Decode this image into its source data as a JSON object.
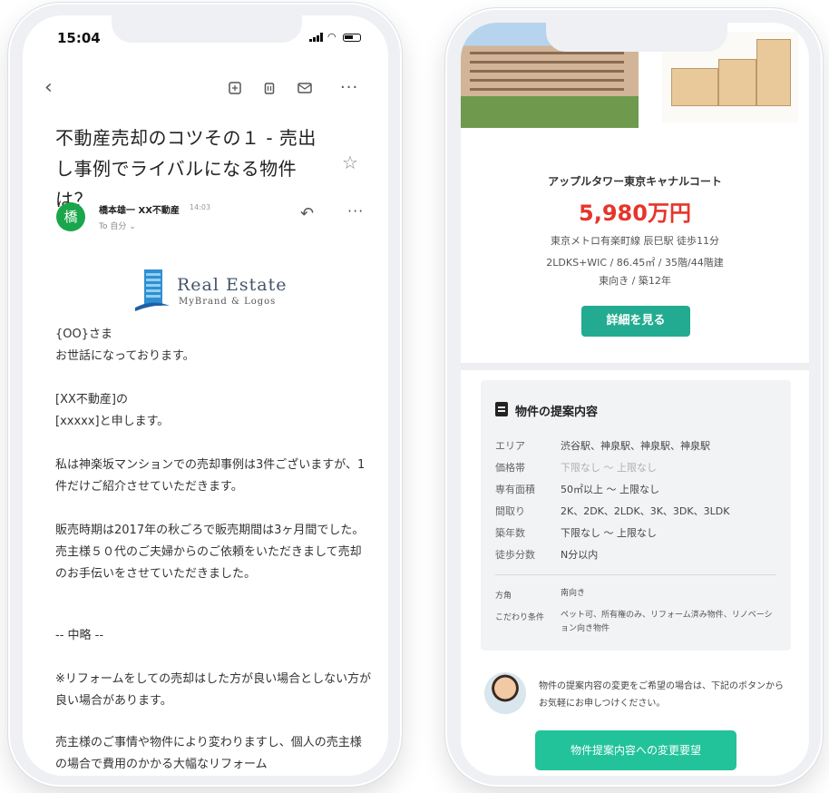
{
  "email": {
    "status_time": "15:04",
    "subject": "不動産売却のコツその１ - 売出し事例でライバルになる物件は？",
    "sender": {
      "initial": "橋",
      "name": "橋本雄一 XX不動産",
      "time": "14:03",
      "to": "To 自分 ⌄"
    },
    "logo": {
      "title": "Real Estate",
      "subtitle": "MyBrand & Logos"
    },
    "body": [
      "{OO}さま\nお世話になっております。",
      "[XX不動産]の\n[xxxxx]と申します。",
      "私は神楽坂マンションでの売却事例は3件ございますが、1件だけご紹介させていただきます。",
      "販売時期は2017年の秋ごろで販売期間は3ヶ月間でした。売主様５０代のご夫婦からのご依頼をいただきまして売却のお手伝いをさせていただきました。",
      "-- 中略 --",
      "※リフォームをしての売却はした方が良い場合としない方が良い場合があります。",
      "売主様のご事情や物件により変わりますし、個人の売主様の場合で費用のかかる大幅なリフォーム"
    ]
  },
  "property": {
    "name": "アップルタワー東京キャナルコート",
    "price": "5,980万円",
    "station": "東京メトロ有楽町線 辰巳駅 徒歩11分",
    "spec": "2LDKS+WIC / 86.45㎡ / 35階/44階建",
    "orientation": "東向き / 築12年",
    "detail_button": "詳細を見る"
  },
  "proposal": {
    "title": "物件の提案内容",
    "conditions": [
      {
        "label": "エリア",
        "value": "渋谷駅、神泉駅、神泉駅、神泉駅",
        "muted": false
      },
      {
        "label": "価格帯",
        "value": "下限なし 〜 上限なし",
        "muted": true
      },
      {
        "label": "専有面積",
        "value": "50㎡以上 〜 上限なし",
        "muted": false
      },
      {
        "label": "間取り",
        "value": "2K、2DK、2LDK、3K、3DK、3LDK",
        "muted": false
      },
      {
        "label": "築年数",
        "value": "下限なし 〜 上限なし",
        "muted": false
      },
      {
        "label": "徒歩分数",
        "value": "N分以内",
        "muted": false
      }
    ],
    "extra": [
      {
        "label": "方角",
        "value": "南向き"
      },
      {
        "label": "こだわり条件",
        "value": "ペット可、所有権のみ、リフォーム済み物件、リノベーション向き物件"
      }
    ],
    "note": "物件の提案内容の変更をご希望の場合は、下記のボタンからお気軽にお申しつけください。",
    "change_button": "物件提案内容への変更要望"
  },
  "colors": {
    "price_red": "#e5362c",
    "button_teal": "#22ab90",
    "button_green": "#22c29a",
    "avatar_green": "#1aa64a"
  }
}
